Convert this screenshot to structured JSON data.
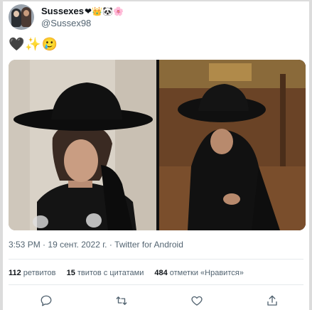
{
  "user": {
    "display_name": "Sussexes",
    "name_emojis": "❤👑🐼🌸",
    "handle": "@Sussex98"
  },
  "tweet": {
    "text": "🖤✨🥲"
  },
  "meta": {
    "time": "3:53 PM",
    "date": "19 сент. 2022 г.",
    "separator": "·",
    "client": "Twitter for Android"
  },
  "stats": {
    "retweets_count": "112",
    "retweets_label": "ретвитов",
    "quotes_count": "15",
    "quotes_label": "твитов с цитатами",
    "likes_count": "484",
    "likes_label": "отметки «Нравится»"
  },
  "icons": {
    "reply": "reply-icon",
    "retweet": "retweet-icon",
    "like": "like-icon",
    "share": "share-icon"
  },
  "colors": {
    "secondary_text": "#536471",
    "primary_text": "#0f1419",
    "divider": "#e5e9ec"
  }
}
